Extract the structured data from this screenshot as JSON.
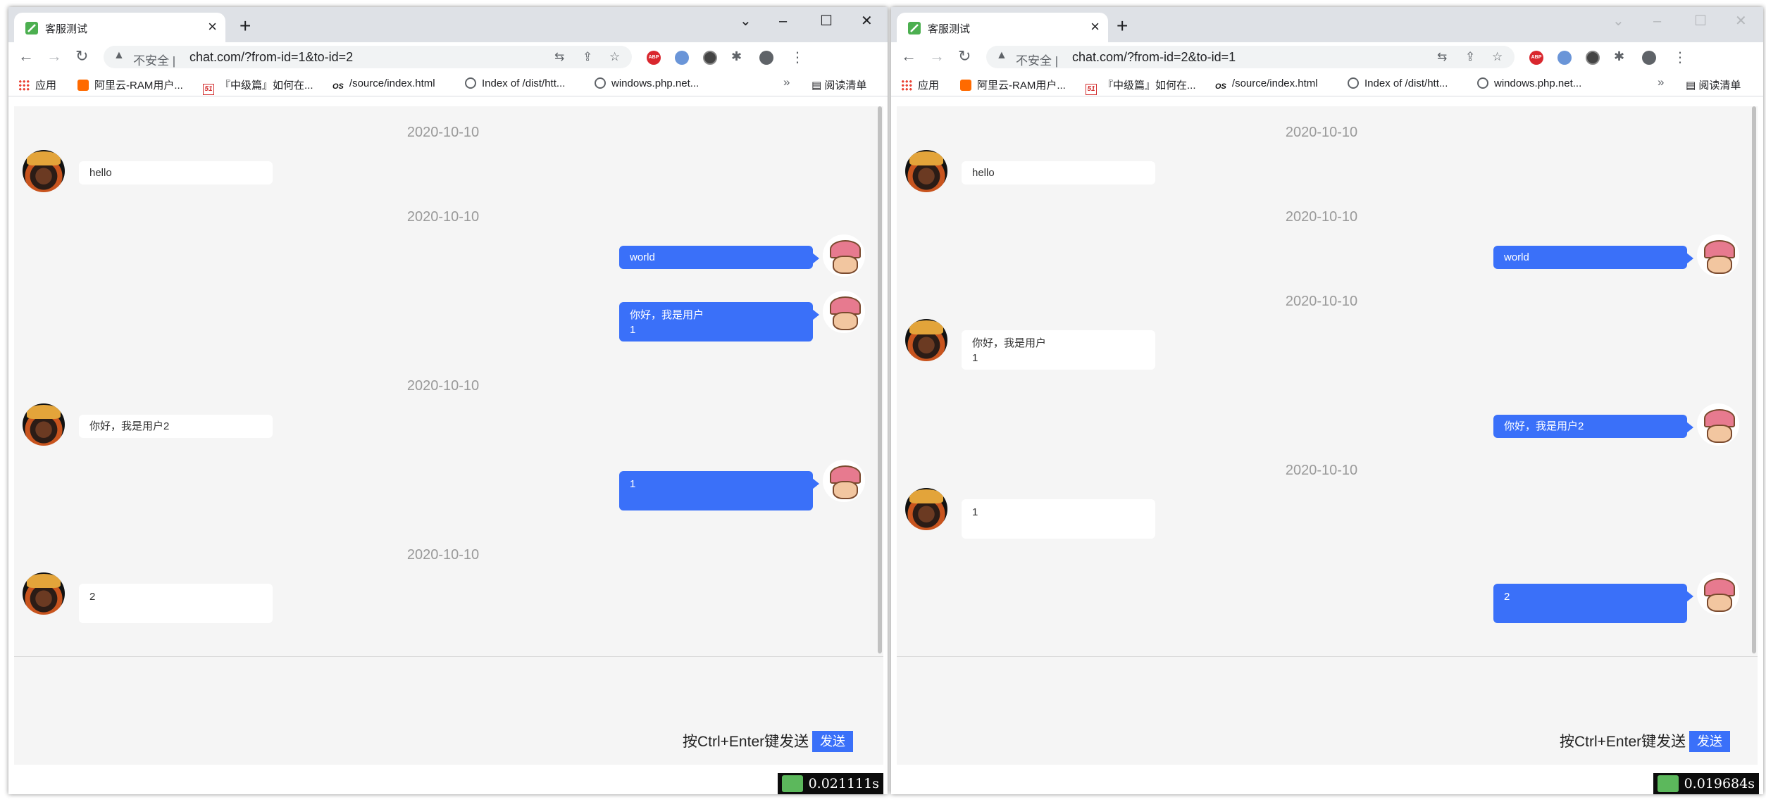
{
  "windows": [
    {
      "tab_title": "客服测试",
      "insecure_label": "不安全 |",
      "url": "chat.com/?from-id=1&to-id=2",
      "bookmarks": [
        {
          "label": "应用",
          "icon": "apps-icon"
        },
        {
          "label": "阿里云-RAM用户...",
          "icon": "aliyun-icon"
        },
        {
          "label": "『中级篇』如何在...",
          "icon": "51cto-icon"
        },
        {
          "label": "/source/index.html",
          "icon": "oschina-icon"
        },
        {
          "label": "Index of /dist/htt...",
          "icon": "globe-icon"
        },
        {
          "label": "windows.php.net...",
          "icon": "globe-icon"
        }
      ],
      "reading_list": "阅读清单",
      "messages": [
        {
          "type": "date",
          "text": "2020-10-10"
        },
        {
          "type": "in",
          "text": "hello"
        },
        {
          "type": "date",
          "text": "2020-10-10"
        },
        {
          "type": "out",
          "text": "world"
        },
        {
          "type": "out",
          "text": "你好，我是用户\n1"
        },
        {
          "type": "date",
          "text": "2020-10-10"
        },
        {
          "type": "in",
          "text": "你好，我是用户2"
        },
        {
          "type": "out",
          "text": "1"
        },
        {
          "type": "date",
          "text": "2020-10-10"
        },
        {
          "type": "in",
          "text": "2"
        }
      ],
      "send_hint": "按Ctrl+Enter键发送",
      "send_label": "发送",
      "timer": "0.021111s"
    },
    {
      "tab_title": "客服测试",
      "insecure_label": "不安全 |",
      "url": "chat.com/?from-id=2&to-id=1",
      "bookmarks": [
        {
          "label": "应用",
          "icon": "apps-icon"
        },
        {
          "label": "阿里云-RAM用户...",
          "icon": "aliyun-icon"
        },
        {
          "label": "『中级篇』如何在...",
          "icon": "51cto-icon"
        },
        {
          "label": "/source/index.html",
          "icon": "oschina-icon"
        },
        {
          "label": "Index of /dist/htt...",
          "icon": "globe-icon"
        },
        {
          "label": "windows.php.net...",
          "icon": "globe-icon"
        }
      ],
      "reading_list": "阅读清单",
      "messages": [
        {
          "type": "date",
          "text": "2020-10-10"
        },
        {
          "type": "in",
          "text": "hello"
        },
        {
          "type": "date",
          "text": "2020-10-10"
        },
        {
          "type": "out",
          "text": "world"
        },
        {
          "type": "date",
          "text": "2020-10-10"
        },
        {
          "type": "in",
          "text": "你好，我是用户\n1"
        },
        {
          "type": "out",
          "text": "你好，我是用户2"
        },
        {
          "type": "date",
          "text": "2020-10-10"
        },
        {
          "type": "in",
          "text": "1"
        },
        {
          "type": "out",
          "text": "2"
        }
      ],
      "send_hint": "按Ctrl+Enter键发送",
      "send_label": "发送",
      "timer": "0.019684s"
    }
  ],
  "colors": {
    "accent": "#3a70f9",
    "chat_background": "#f5f5f5",
    "date_text": "#999999"
  }
}
